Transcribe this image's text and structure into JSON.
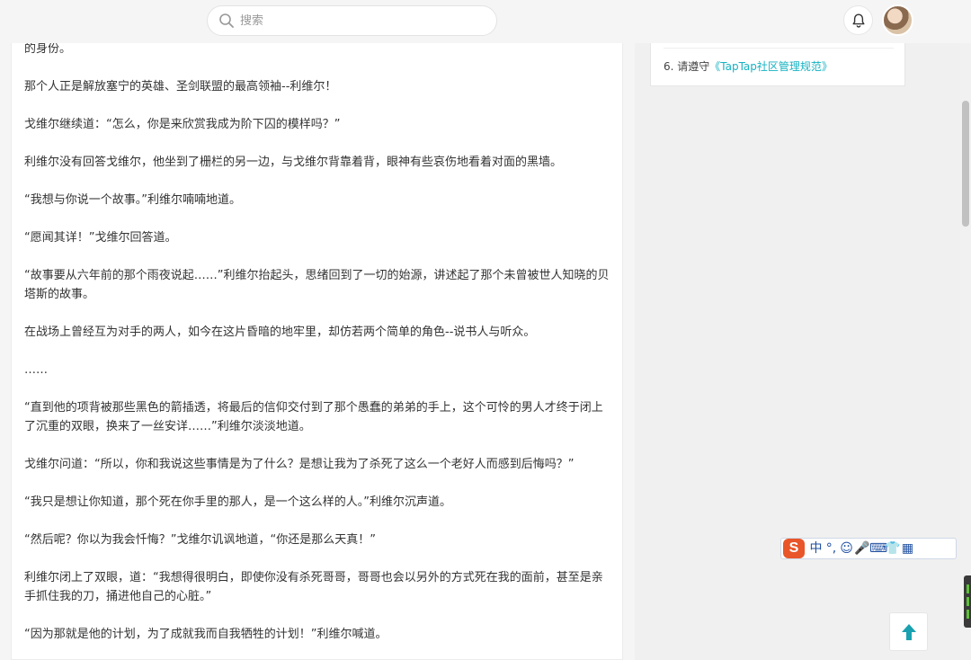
{
  "header": {
    "search_placeholder": "搜索"
  },
  "article": {
    "paragraphs": [
      "“真是精彩啊，可爱的领袖大人！”戈维尔闭上双眼道，虽然他没有回头，却依然从这沉重的步伐声中，判断出来者的身份。",
      "那个人正是解放塞宁的英雄、圣剑联盟的最高领袖--利维尔！",
      "戈维尔继续道：“怎么，你是来欣赏我成为阶下囚的模样吗？”",
      "利维尔没有回答戈维尔，他坐到了栅栏的另一边，与戈维尔背靠着背，眼神有些哀伤地看着对面的黑墙。",
      "“我想与你说一个故事。”利维尔喃喃地道。",
      "“愿闻其详！”戈维尔回答道。",
      "“故事要从六年前的那个雨夜说起……”利维尔抬起头，思绪回到了一切的始源，讲述起了那个未曾被世人知晓的贝塔斯的故事。",
      "在战场上曾经互为对手的两人，如今在这片昏暗的地牢里，却仿若两个简单的角色--说书人与听众。",
      "……",
      "“直到他的项背被那些黑色的箭插透，将最后的信仰交付到了那个愚蠢的弟弟的手上，这个可怜的男人才终于闭上了沉重的双眼，换来了一丝安详……”利维尔淡淡地道。",
      "戈维尔问道：“所以，你和我说这些事情是为了什么？是想让我为了杀死了这么一个老好人而感到后悔吗？”",
      "“我只是想让你知道，那个死在你手里的那人，是一个这么样的人。”利维尔沉声道。",
      "“然后呢？你以为我会忏悔？”戈维尔讥讽地道，“你还是那么天真！”",
      "利维尔闭上了双眼，道：“我想得很明白，即使你没有杀死哥哥，哥哥也会以另外的方式死在我的面前，甚至是亲手抓住我的刀，捅进他自己的心脏。”",
      "“因为那就是他的计划，为了成就我而自我牺牲的计划！”利维尔喊道。"
    ]
  },
  "sidebar": {
    "rule_prefix": "6. 请遵守",
    "rule_link": "《TapTap社区管理规范》"
  },
  "ime": {
    "logo": "S",
    "items": [
      "中",
      "°,",
      "☺",
      "🎤",
      "⌨",
      "👕",
      "▦"
    ]
  },
  "colors": {
    "link": "#16b2c1",
    "back_top_arrow": "#1aa1b0",
    "ime_logo": "#e8562a"
  },
  "icons": [
    "search-icon",
    "bell-icon",
    "arrow-up-icon"
  ]
}
